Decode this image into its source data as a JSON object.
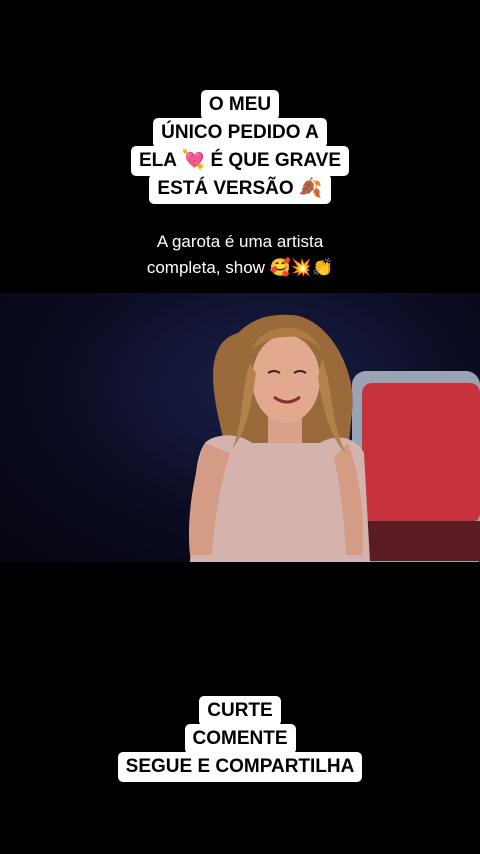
{
  "top_caption": {
    "lines": [
      "O MEU",
      "ÚNICO PEDIDO A",
      "ELA 💘 É QUE GRAVE",
      "ESTÁ VERSÃO 🍂"
    ]
  },
  "subtitle": {
    "lines": [
      "A garota é uma artista",
      "completa, show 🥰💥👏"
    ]
  },
  "video": {
    "description_icon": "singer-video-frame"
  },
  "bottom_caption": {
    "lines": [
      "CURTE",
      "COMENTE",
      "SEGUE E COMPARTILHA"
    ]
  },
  "colors": {
    "background": "#000000",
    "caption_bg": "#ffffff",
    "chair_red": "#c8323c"
  }
}
